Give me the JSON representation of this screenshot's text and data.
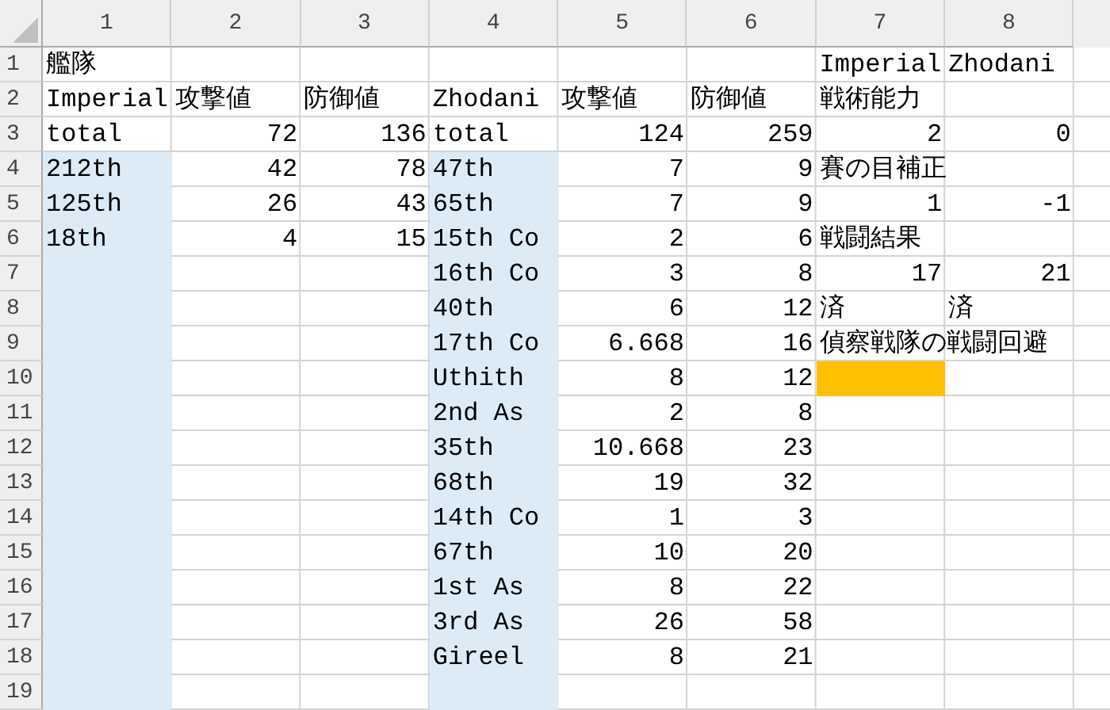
{
  "columns": [
    "1",
    "2",
    "3",
    "4",
    "5",
    "6",
    "7",
    "8"
  ],
  "rows": [
    {
      "label": "1",
      "cells": [
        {
          "text": "艦隊",
          "kind": "text"
        },
        null,
        null,
        null,
        null,
        null,
        {
          "text": "Imperial",
          "kind": "text"
        },
        {
          "text": "Zhodani",
          "kind": "text"
        }
      ]
    },
    {
      "label": "2",
      "cells": [
        {
          "text": "Imperial",
          "kind": "text"
        },
        {
          "text": "攻撃値",
          "kind": "text"
        },
        {
          "text": "防御値",
          "kind": "text"
        },
        {
          "text": "Zhodani",
          "kind": "text"
        },
        {
          "text": "攻撃値",
          "kind": "text"
        },
        {
          "text": "防御値",
          "kind": "text"
        },
        {
          "text": "戦術能力",
          "kind": "text"
        },
        null
      ]
    },
    {
      "label": "3",
      "cells": [
        {
          "text": "total",
          "kind": "text"
        },
        {
          "text": "72",
          "kind": "number"
        },
        {
          "text": "136",
          "kind": "number"
        },
        {
          "text": "total",
          "kind": "text"
        },
        {
          "text": "124",
          "kind": "number"
        },
        {
          "text": "259",
          "kind": "number"
        },
        {
          "text": "2",
          "kind": "number"
        },
        {
          "text": "0",
          "kind": "number"
        }
      ]
    },
    {
      "label": "4",
      "cells": [
        {
          "text": "212th",
          "kind": "text",
          "color": "#ddebf7"
        },
        {
          "text": "42",
          "kind": "number"
        },
        {
          "text": "78",
          "kind": "number"
        },
        {
          "text": "47th",
          "kind": "text",
          "color": "#ddebf7"
        },
        {
          "text": "7",
          "kind": "number"
        },
        {
          "text": "9",
          "kind": "number"
        },
        {
          "text": "賽の目補正",
          "kind": "text"
        },
        null
      ]
    },
    {
      "label": "5",
      "cells": [
        {
          "text": "125th",
          "kind": "text",
          "color": "#ddebf7"
        },
        {
          "text": "26",
          "kind": "number"
        },
        {
          "text": "43",
          "kind": "number"
        },
        {
          "text": "65th",
          "kind": "text",
          "color": "#ddebf7"
        },
        {
          "text": "7",
          "kind": "number"
        },
        {
          "text": "9",
          "kind": "number"
        },
        {
          "text": "1",
          "kind": "number"
        },
        {
          "text": "-1",
          "kind": "number"
        }
      ]
    },
    {
      "label": "6",
      "cells": [
        {
          "text": "18th",
          "kind": "text",
          "color": "#ddebf7"
        },
        {
          "text": "4",
          "kind": "number"
        },
        {
          "text": "15",
          "kind": "number"
        },
        {
          "text": "15th Co",
          "kind": "text",
          "color": "#ddebf7"
        },
        {
          "text": "2",
          "kind": "number"
        },
        {
          "text": "6",
          "kind": "number"
        },
        {
          "text": "戦闘結果",
          "kind": "text"
        },
        null
      ]
    },
    {
      "label": "7",
      "cells": [
        {
          "kind": "empty",
          "color": "#ddebf7"
        },
        null,
        null,
        {
          "text": "16th Co",
          "kind": "text",
          "color": "#ddebf7"
        },
        {
          "text": "3",
          "kind": "number"
        },
        {
          "text": "8",
          "kind": "number"
        },
        {
          "text": "17",
          "kind": "number"
        },
        {
          "text": "21",
          "kind": "number"
        }
      ]
    },
    {
      "label": "8",
      "cells": [
        {
          "kind": "empty",
          "color": "#ddebf7"
        },
        null,
        null,
        {
          "text": "40th",
          "kind": "text",
          "color": "#ddebf7"
        },
        {
          "text": "6",
          "kind": "number"
        },
        {
          "text": "12",
          "kind": "number"
        },
        {
          "text": "済",
          "kind": "text"
        },
        {
          "text": "済",
          "kind": "text"
        }
      ]
    },
    {
      "label": "9",
      "cells": [
        {
          "kind": "empty",
          "color": "#ddebf7"
        },
        null,
        null,
        {
          "text": "17th Co",
          "kind": "text",
          "color": "#ddebf7"
        },
        {
          "text": "6.668",
          "kind": "number"
        },
        {
          "text": "16",
          "kind": "number"
        },
        {
          "text": "偵察戦隊の戦闘回避",
          "kind": "text"
        },
        null
      ]
    },
    {
      "label": "10",
      "cells": [
        {
          "kind": "empty",
          "color": "#ddebf7"
        },
        null,
        null,
        {
          "text": "Uthith",
          "kind": "text",
          "color": "#ddebf7"
        },
        {
          "text": "8",
          "kind": "number"
        },
        {
          "text": "12",
          "kind": "number"
        },
        {
          "kind": "empty",
          "color": "#ffc000"
        },
        null
      ]
    },
    {
      "label": "11",
      "cells": [
        {
          "kind": "empty",
          "color": "#ddebf7"
        },
        null,
        null,
        {
          "text": "2nd As",
          "kind": "text",
          "color": "#ddebf7"
        },
        {
          "text": "2",
          "kind": "number"
        },
        {
          "text": "8",
          "kind": "number"
        },
        null,
        null
      ]
    },
    {
      "label": "12",
      "cells": [
        {
          "kind": "empty",
          "color": "#ddebf7"
        },
        null,
        null,
        {
          "text": "35th",
          "kind": "text",
          "color": "#ddebf7"
        },
        {
          "text": "10.668",
          "kind": "number"
        },
        {
          "text": "23",
          "kind": "number"
        },
        null,
        null
      ]
    },
    {
      "label": "13",
      "cells": [
        {
          "kind": "empty",
          "color": "#ddebf7"
        },
        null,
        null,
        {
          "text": "68th",
          "kind": "text",
          "color": "#ddebf7"
        },
        {
          "text": "19",
          "kind": "number"
        },
        {
          "text": "32",
          "kind": "number"
        },
        null,
        null
      ]
    },
    {
      "label": "14",
      "cells": [
        {
          "kind": "empty",
          "color": "#ddebf7"
        },
        null,
        null,
        {
          "text": "14th Co",
          "kind": "text",
          "color": "#ddebf7"
        },
        {
          "text": "1",
          "kind": "number"
        },
        {
          "text": "3",
          "kind": "number"
        },
        null,
        null
      ]
    },
    {
      "label": "15",
      "cells": [
        {
          "kind": "empty",
          "color": "#ddebf7"
        },
        null,
        null,
        {
          "text": "67th",
          "kind": "text",
          "color": "#ddebf7"
        },
        {
          "text": "10",
          "kind": "number"
        },
        {
          "text": "20",
          "kind": "number"
        },
        null,
        null
      ]
    },
    {
      "label": "16",
      "cells": [
        {
          "kind": "empty",
          "color": "#ddebf7"
        },
        null,
        null,
        {
          "text": "1st As",
          "kind": "text",
          "color": "#ddebf7"
        },
        {
          "text": "8",
          "kind": "number"
        },
        {
          "text": "22",
          "kind": "number"
        },
        null,
        null
      ]
    },
    {
      "label": "17",
      "cells": [
        {
          "kind": "empty",
          "color": "#ddebf7"
        },
        null,
        null,
        {
          "text": "3rd As",
          "kind": "text",
          "color": "#ddebf7"
        },
        {
          "text": "26",
          "kind": "number"
        },
        {
          "text": "58",
          "kind": "number"
        },
        null,
        null
      ]
    },
    {
      "label": "18",
      "cells": [
        {
          "kind": "empty",
          "color": "#ddebf7"
        },
        null,
        null,
        {
          "text": "Gireel",
          "kind": "text",
          "color": "#ddebf7"
        },
        {
          "text": "8",
          "kind": "number"
        },
        {
          "text": "21",
          "kind": "number"
        },
        null,
        null
      ]
    },
    {
      "label": "19",
      "cells": [
        {
          "kind": "empty",
          "color": "#ddebf7"
        },
        null,
        null,
        {
          "kind": "empty",
          "color": "#ddebf7"
        },
        null,
        null,
        null,
        null
      ]
    }
  ]
}
